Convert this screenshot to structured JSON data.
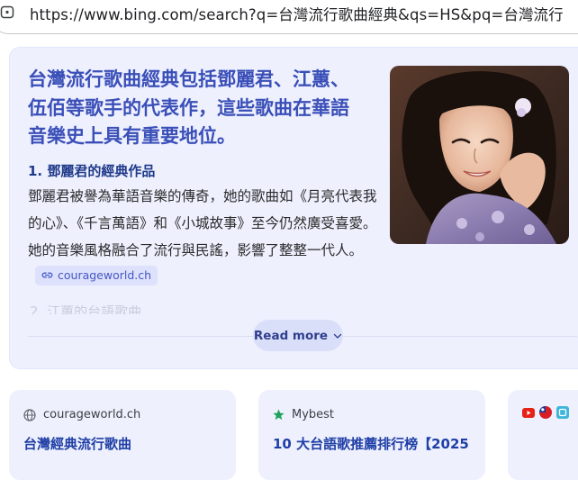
{
  "browser": {
    "url": "https://www.bing.com/search?q=台灣流行歌曲經典&qs=HS&pq=台灣流行"
  },
  "answer": {
    "title": "台灣流行歌曲經典包括鄧麗君、江蕙、伍佰等歌手的代表作，這些歌曲在華語音樂史上具有重要地位。",
    "section_heading": "1. 鄧麗君的經典作品",
    "section_body": "鄧麗君被譽為華語音樂的傳奇，她的歌曲如《月亮代表我的心》、《千言萬語》和《小城故事》至今仍然廣受喜愛。她的音樂風格融合了流行與民謠，影響了整整一代人。",
    "citation": "courageworld.ch",
    "faded_text": "2. 江蕙的台語歌曲",
    "read_more": "Read more",
    "accent_color": "#3a4fb8"
  },
  "results": [
    {
      "source": "courageworld.ch",
      "source_icon": "globe-icon",
      "title": "台灣經典流行歌曲"
    },
    {
      "source": "Mybest",
      "source_icon": "star-icon",
      "title": "10 大台語歌推薦排行榜【2025"
    },
    {
      "source_icons": [
        "youtube-icon",
        "taiwan-flag-icon",
        "app-icon"
      ]
    }
  ]
}
